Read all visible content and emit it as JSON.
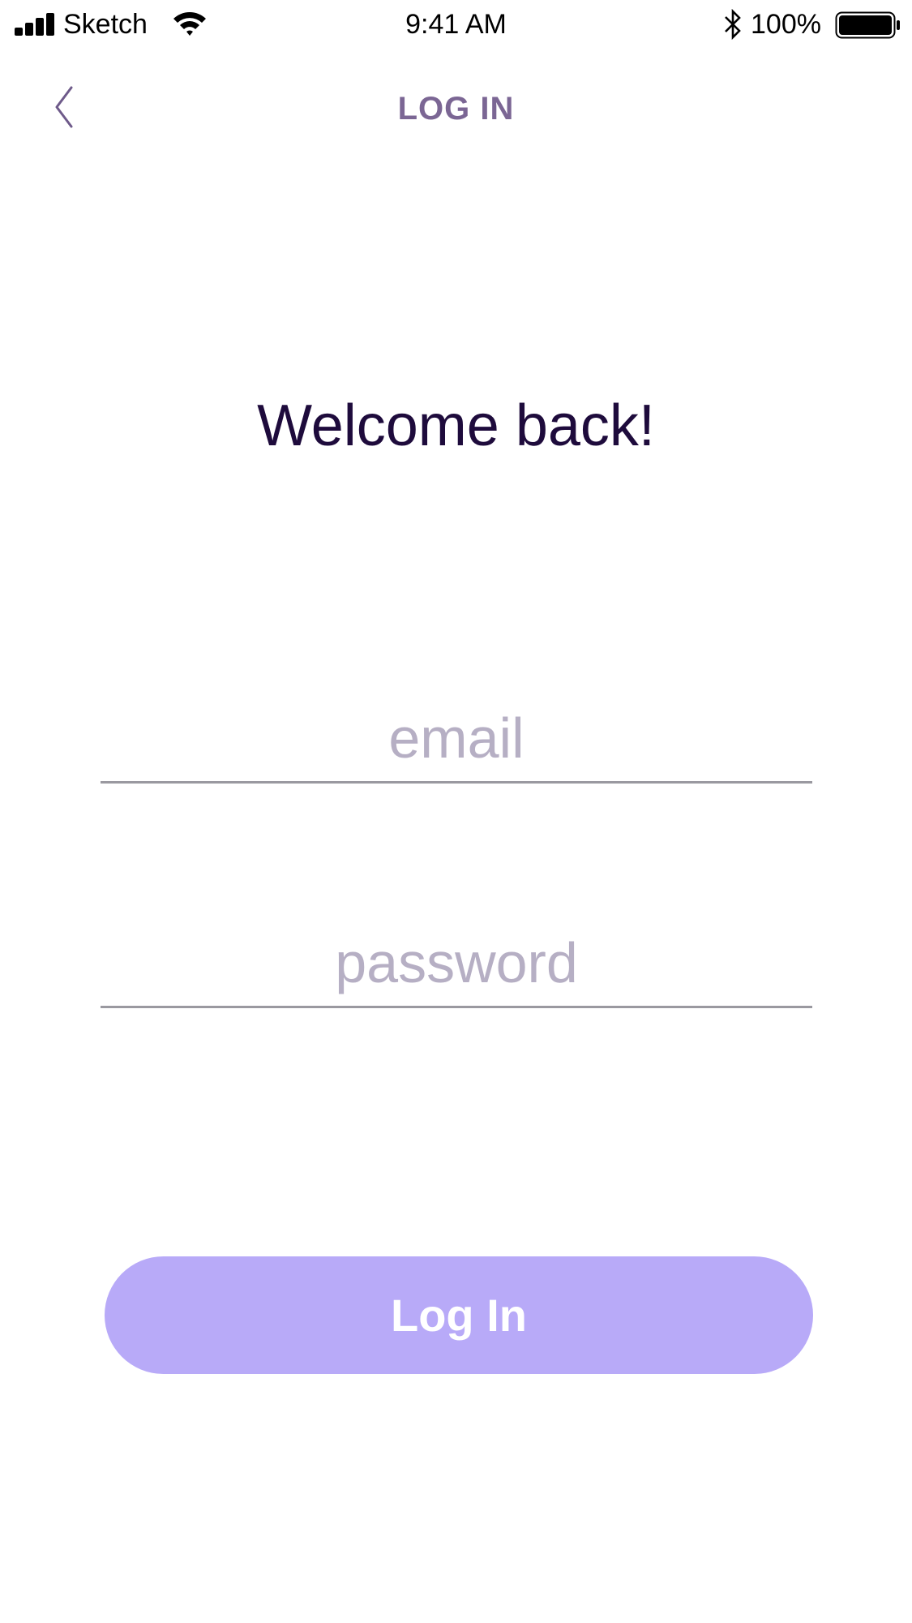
{
  "status_bar": {
    "carrier": "Sketch",
    "time": "9:41 AM",
    "battery_percent": "100%",
    "icons": [
      "signal-icon",
      "wifi-icon",
      "bluetooth-icon",
      "battery-icon"
    ]
  },
  "nav": {
    "title": "LOG IN",
    "back_icon": "chevron-left-icon"
  },
  "heading": "Welcome back!",
  "form": {
    "email_placeholder": "email",
    "email_value": "",
    "password_placeholder": "password",
    "password_value": "",
    "submit_label": "Log In"
  },
  "colors": {
    "title": "#7b6694",
    "heading": "#1e0b3c",
    "placeholder": "#b6afc4",
    "underline": "#9a99a0",
    "button_bg": "#b8aaf8",
    "button_text": "#ffffff"
  }
}
